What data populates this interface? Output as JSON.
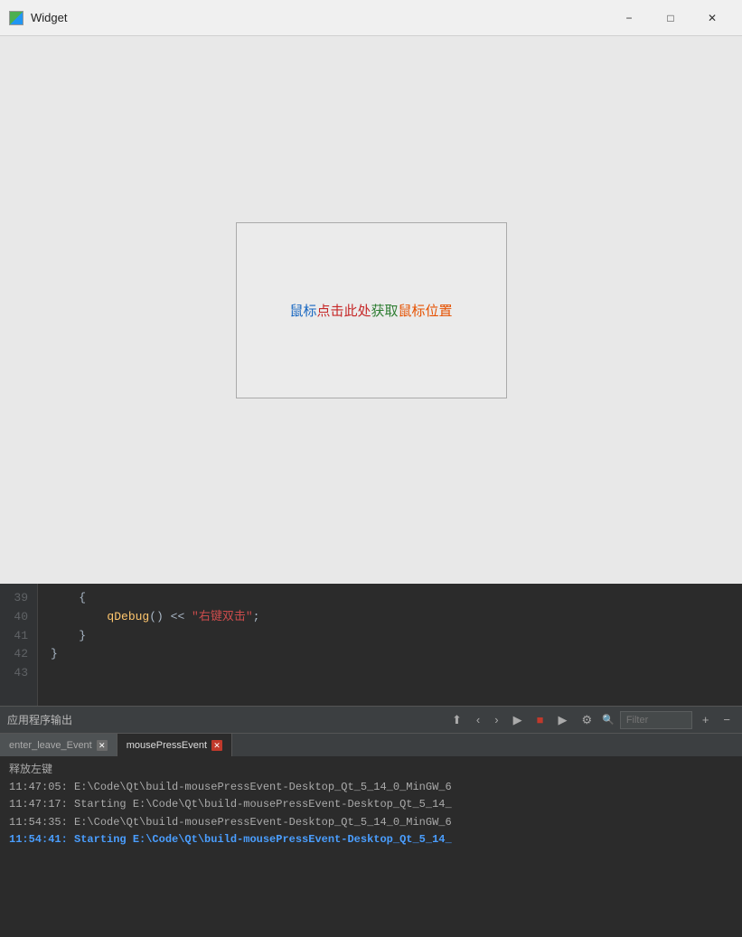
{
  "titleBar": {
    "title": "Widget",
    "minimize": "−",
    "maximize": "□",
    "close": "✕"
  },
  "widget": {
    "innerText": "鼠标点击此处获取鼠标位置"
  },
  "codeEditor": {
    "lines": [
      "39",
      "40",
      "41",
      "42",
      "43"
    ],
    "code": [
      "    {",
      "        qDebug() << \"右键双击\";",
      "    }",
      "}",
      ""
    ]
  },
  "bottomPanel": {
    "title": "应用程序输出",
    "filterPlaceholder": "Filter",
    "plusBtn": "+",
    "minusBtn": "−",
    "tabs": [
      {
        "label": "enter_leave_Event",
        "active": false,
        "closeable": true
      },
      {
        "label": "mousePressEvent",
        "active": true,
        "closeable": true
      }
    ],
    "outputLines": [
      {
        "text": "释放左键",
        "bold": false,
        "blue": false
      },
      {
        "text": "",
        "bold": false,
        "blue": false
      },
      {
        "text": "11:47:05: E:\\Code\\Qt\\build-mousePressEvent-Desktop_Qt_5_14_0_MinGW_6",
        "bold": false,
        "blue": false
      },
      {
        "text": "",
        "bold": false,
        "blue": false
      },
      {
        "text": "11:47:17: Starting E:\\Code\\Qt\\build-mousePressEvent-Desktop_Qt_5_14_",
        "bold": false,
        "blue": false
      },
      {
        "text": "11:54:35: E:\\Code\\Qt\\build-mousePressEvent-Desktop_Qt_5_14_0_MinGW_6",
        "bold": false,
        "blue": false
      },
      {
        "text": "",
        "bold": false,
        "blue": false
      },
      {
        "text": "11:54:41: Starting E:\\Code\\Qt\\build-mousePressEvent-Desktop_Qt_5_14_",
        "bold": true,
        "blue": true
      }
    ]
  }
}
